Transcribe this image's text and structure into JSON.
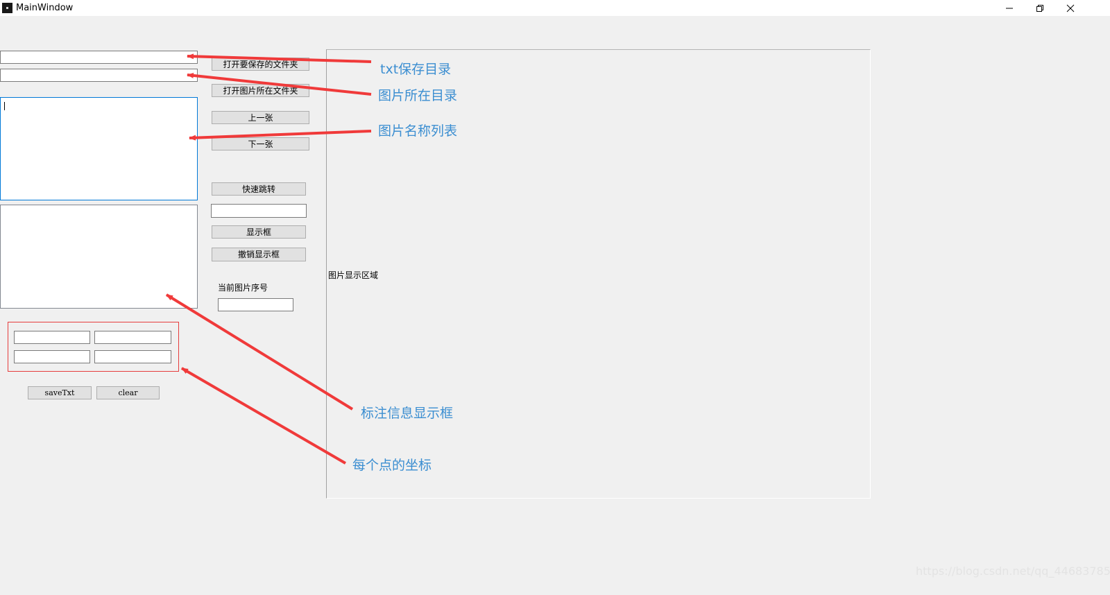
{
  "window": {
    "title": "MainWindow",
    "controls": [
      "minimize-icon",
      "restore-icon",
      "close-icon"
    ]
  },
  "form": {
    "save_dir_input": {
      "value": ""
    },
    "image_dir_input": {
      "value": ""
    },
    "open_save_folder_button": "打开要保存的文件夹",
    "open_image_folder_button": "打开图片所在文件夹",
    "prev_button": "上一张",
    "next_button": "下一张",
    "quick_jump_button": "快速跳转",
    "jump_input": {
      "value": ""
    },
    "show_box_button": "显示框",
    "undo_box_button": "撤销显示框",
    "current_index_label": "当前图片序号",
    "current_index_input": {
      "value": ""
    },
    "coord_inputs": [
      "",
      "",
      "",
      ""
    ],
    "save_txt_button": "saveTxt",
    "clear_button": "clear",
    "image_area_label": "图片显示区域"
  },
  "annotations": {
    "txt_dir": "txt保存目录",
    "image_dir": "图片所在目录",
    "name_list": "图片名称列表",
    "label_info": "标注信息显示框",
    "point_coords": "每个点的坐标"
  },
  "colors": {
    "arrow": "#f03a3a",
    "annotation_text": "#3b8ed1",
    "group_border": "#e63c3c",
    "focus_border": "#0078d7"
  },
  "watermark": "https://blog.csdn.net/qq_44683785"
}
